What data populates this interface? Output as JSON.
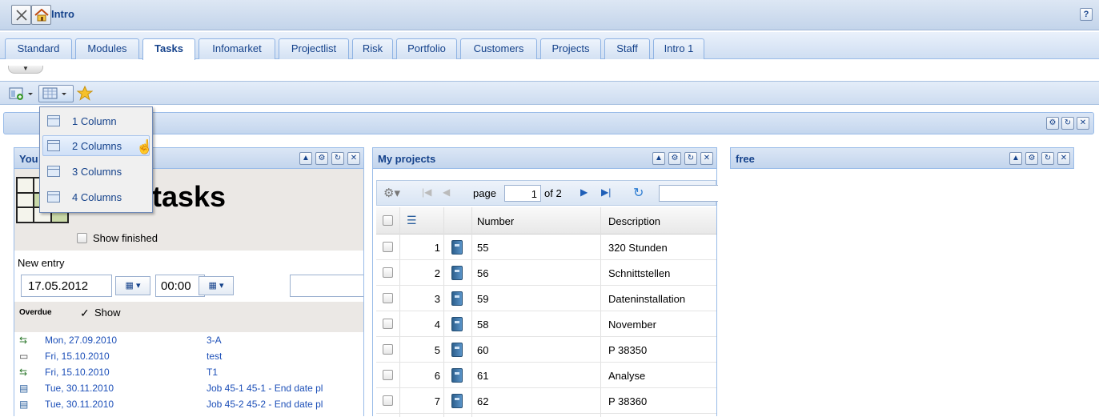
{
  "app": {
    "title": "Intro",
    "help": "?"
  },
  "tabs": [
    "Standard",
    "Modules",
    "Tasks",
    "Infomarket",
    "Projectlist",
    "Risk",
    "Portfolio",
    "Customers",
    "Projects",
    "Staff",
    "Intro 1"
  ],
  "active_tab": "Tasks",
  "layout_menu": {
    "items": [
      "1 Column",
      "2 Columns",
      "3 Columns",
      "4 Columns"
    ],
    "hovered": "2 Columns"
  },
  "tasks_panel": {
    "title_partial": "You",
    "big_title": "tasks",
    "show_finished": "Show finished",
    "new_entry": "New entry",
    "date": "17.05.2012",
    "time": "00:00",
    "overdue": "Overdue",
    "show": "Show",
    "rows": [
      {
        "date": "Mon, 27.09.2010",
        "text": "3-A",
        "icon": "workflow-icon"
      },
      {
        "date": "Fri, 15.10.2010",
        "text": "test",
        "icon": "bus-icon"
      },
      {
        "date": "Fri, 15.10.2010",
        "text": "T1",
        "icon": "workflow-icon"
      },
      {
        "date": "Tue, 30.11.2010",
        "text": "Job 45-1 45-1 - End date pl",
        "icon": "clipboard-icon"
      },
      {
        "date": "Tue, 30.11.2010",
        "text": "Job 45-2 45-2 - End date pl",
        "icon": "clipboard-icon"
      }
    ]
  },
  "projects_panel": {
    "title": "My projects",
    "page_label": "page",
    "page": "1",
    "of": "of 2",
    "columns": [
      "Number",
      "Description"
    ],
    "rows": [
      {
        "n": "1",
        "number": "55",
        "description": "320 Stunden"
      },
      {
        "n": "2",
        "number": "56",
        "description": "Schnittstellen"
      },
      {
        "n": "3",
        "number": "59",
        "description": "Dateninstallation"
      },
      {
        "n": "4",
        "number": "58",
        "description": "November"
      },
      {
        "n": "5",
        "number": "60",
        "description": "P 38350"
      },
      {
        "n": "6",
        "number": "61",
        "description": "Analyse"
      },
      {
        "n": "7",
        "number": "62",
        "description": "P 38360"
      }
    ]
  },
  "free_panel": {
    "title": "free"
  }
}
